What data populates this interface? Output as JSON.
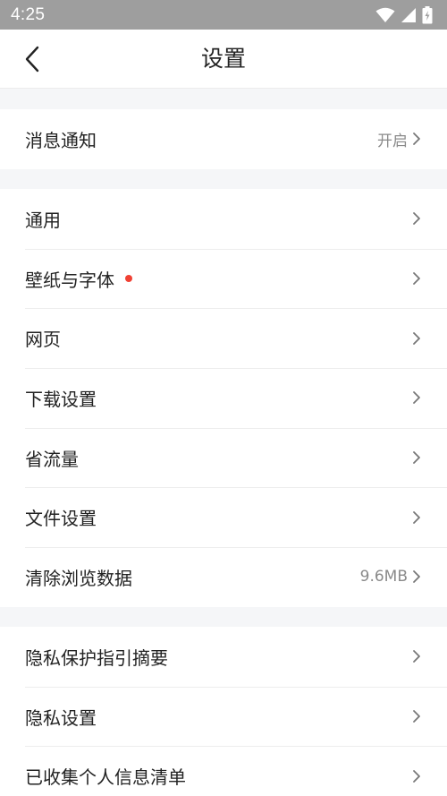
{
  "status_bar": {
    "time": "4:25",
    "icons": [
      "wifi-icon",
      "signal-icon",
      "battery-charging-icon"
    ]
  },
  "header": {
    "back_icon": "chevron-left-icon",
    "title": "设置"
  },
  "groups": [
    {
      "items": [
        {
          "label": "消息通知",
          "value": "开启"
        }
      ]
    },
    {
      "items": [
        {
          "label": "通用",
          "value": ""
        },
        {
          "label": "壁纸与字体",
          "value": "",
          "badge": "red-dot"
        },
        {
          "label": "网页",
          "value": ""
        },
        {
          "label": "下载设置",
          "value": ""
        },
        {
          "label": "省流量",
          "value": ""
        },
        {
          "label": "文件设置",
          "value": ""
        },
        {
          "label": "清除浏览数据",
          "value": "9.6MB"
        }
      ]
    },
    {
      "items": [
        {
          "label": "隐私保护指引摘要",
          "value": ""
        },
        {
          "label": "隐私设置",
          "value": ""
        },
        {
          "label": "已收集个人信息清单",
          "value": ""
        }
      ]
    }
  ],
  "colors": {
    "status_bar_bg": "#9e9e9e",
    "page_bg": "#f5f6f8",
    "badge": "#f04134",
    "secondary_text": "#8a8a8a"
  }
}
